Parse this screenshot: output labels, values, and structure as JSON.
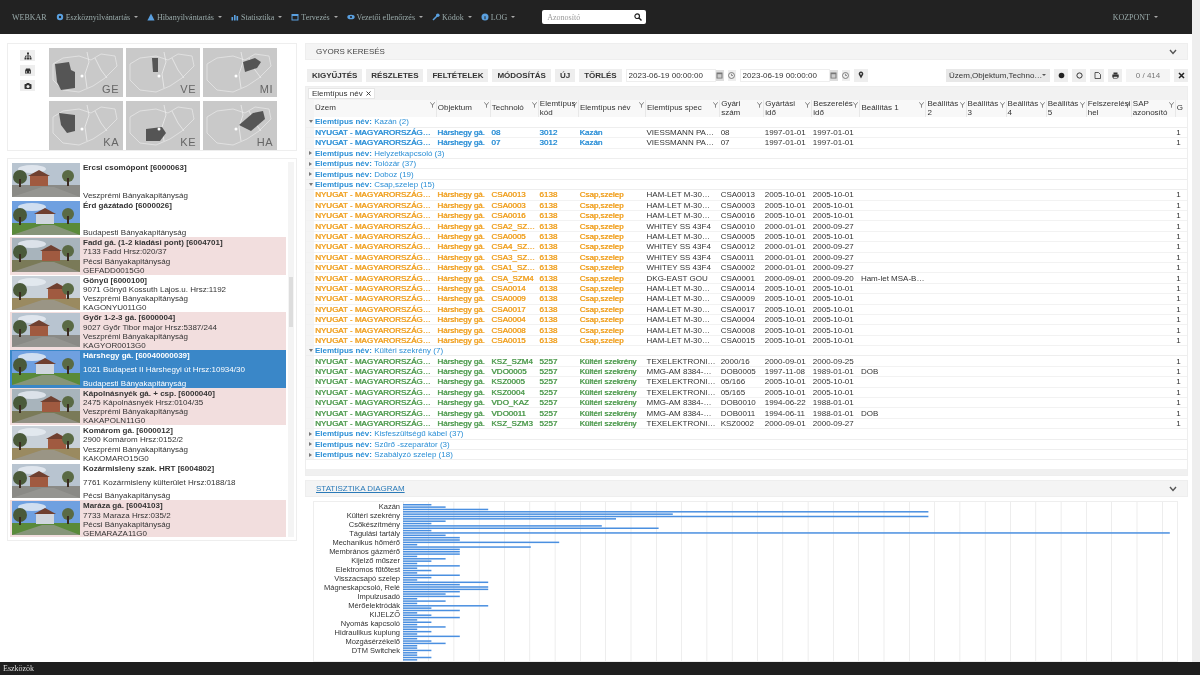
{
  "navbar": {
    "brand": "WEBKAR",
    "menus": [
      {
        "label": "Eszköznyilvántartás"
      },
      {
        "label": "Hibanyilvántartás"
      },
      {
        "label": "Statisztika"
      },
      {
        "label": "Tervezés"
      },
      {
        "label": "Vezetői ellenőrzés"
      },
      {
        "label": "Kódok"
      },
      {
        "label": "LOG"
      }
    ],
    "search": {
      "placeholder": "Azonosító"
    },
    "user_menu": "KOZPONT"
  },
  "region_maps": [
    {
      "code": "GE"
    },
    {
      "code": "VE"
    },
    {
      "code": "MI"
    },
    {
      "code": "KA"
    },
    {
      "code": "KE"
    },
    {
      "code": "HA"
    }
  ],
  "stations": [
    {
      "name": "Ercsi csomópont [6000063]",
      "authority": "Veszprémi Bányakapitányság",
      "flagged": false,
      "selected": false
    },
    {
      "name": "Érd gázátadó [6000026]",
      "authority": "Budapesti Bányakapitányság",
      "flagged": false,
      "selected": false
    },
    {
      "name": "Fadd gá. (1-2 kiadási pont) [6004701]",
      "address": "7133 Fadd Hrsz:020/37",
      "authority": "Pécsi Bányakapitányság",
      "code": "GEFADD0015G0",
      "flagged": true,
      "selected": false
    },
    {
      "name": "Gönyű [6000100]",
      "address": "9071 Gönyű Kossuth Lajos.u. Hrsz:1192",
      "authority": "Veszprémi Bányakapitányság",
      "code": "KAGONYU011G0",
      "flagged": false,
      "selected": false
    },
    {
      "name": "Győr 1-2-3 gá. [6000004]",
      "address": "9027 Győr Tibor major Hrsz:5387/244",
      "authority": "Veszprémi Bányakapitányság",
      "code": "KAGYOR0013G0",
      "flagged": true,
      "selected": false
    },
    {
      "name": "Hárshegy gá. [60040000039]",
      "address": "1021 Budapest II Hárshegyi út Hrsz:10934/30",
      "authority": "Budapesti Bányakapitányság",
      "flagged": false,
      "selected": true
    },
    {
      "name": "Kápolnásnyék gá. + csp. [6000040]",
      "address": "2475 Kápolnásnyék Hrsz:0104/35",
      "authority": "Veszprémi Bányakapitányság",
      "code": "KAKAPOLN11G0",
      "flagged": true,
      "selected": false
    },
    {
      "name": "Komárom gá. [6000012]",
      "address": "2900 Komárom Hrsz:0152/2",
      "authority": "Veszprémi Bányakapitányság",
      "code": "KAKOMARO15G0",
      "flagged": false,
      "selected": false
    },
    {
      "name": "Kozármisleny szak. HRT [6004802]",
      "address": "7761 Kozármisleny külterület Hrsz:0188/18",
      "authority": "Pécsi Bányakapitányság",
      "flagged": false,
      "selected": false
    },
    {
      "name": "Maráza gá. [6004103]",
      "address": "7733 Maraza Hrsz:035/2",
      "authority": "Pécsi Bányakapitányság",
      "code": "GEMARAZA11G0",
      "flagged": true,
      "selected": false
    }
  ],
  "quick_search": {
    "title": "GYORS KERESÉS",
    "buttons": [
      "KIGYŰJTÉS",
      "RÉSZLETES",
      "FELTÉTELEK",
      "MÓDOSÍTÁS",
      "ÚJ",
      "TÖRLÉS"
    ],
    "date_from": "2023-06-19 00:00:00",
    "date_to": "2023-06-19 00:00:00",
    "columns_select": "Üzem,Objektum,Techno…",
    "counter": "0 / 414"
  },
  "table": {
    "group_chip": "Elemtípus név",
    "columns": [
      {
        "label": "Üzem",
        "filter": true
      },
      {
        "label": "Objektum",
        "filter": true
      },
      {
        "label": "Technoló",
        "filter": true
      },
      {
        "label": "Elemtípus kód",
        "filter": true
      },
      {
        "label": "Elemtípus név",
        "filter": true
      },
      {
        "label": "Elemtípus spec",
        "filter": true
      },
      {
        "label": "Gyári szám",
        "filter": true
      },
      {
        "label": "Gyártási idő",
        "filter": true
      },
      {
        "label": "Beszerelés idő",
        "filter": true
      },
      {
        "label": "Beállítás 1",
        "filter": true
      },
      {
        "label": "Beállítás 2",
        "filter": true
      },
      {
        "label": "Beállítás 3",
        "filter": true
      },
      {
        "label": "Beállítás 4",
        "filter": true
      },
      {
        "label": "Beállítás 5",
        "filter": true
      },
      {
        "label": "Felszerelési hel",
        "filter": true
      },
      {
        "label": "SAP azonosító",
        "filter": true
      },
      {
        "label": "G",
        "filter": false
      }
    ],
    "groups": [
      {
        "title": "**Elemtípus név:** Kazán (2)",
        "expanded": true,
        "color": "#2b8fd6",
        "rows": [
          {
            "plant": "NYUGAT - MAGYARORSZÁG…",
            "object": "Hárshegy gá.",
            "technology": "08",
            "type_code": "3012",
            "type_name": "Kazán",
            "type_spec": "VIESSMANN PA…",
            "serial": "08",
            "manufactured": "1997-01-01",
            "installed": "1997-01-01",
            "column_17": "1"
          },
          {
            "plant": "NYUGAT - MAGYARORSZÁG…",
            "object": "Hárshegy gá.",
            "technology": "07",
            "type_code": "3012",
            "type_name": "Kazán",
            "type_spec": "VIESSMANN PA…",
            "serial": "07",
            "manufactured": "1997-01-01",
            "installed": "1997-01-01",
            "column_17": "1"
          }
        ]
      },
      {
        "title": "**Elemtípus név:** Helyzetkapcsoló (3)",
        "expanded": false
      },
      {
        "title": "**Elemtípus név:** Tolózár (37)",
        "expanded": false
      },
      {
        "title": "**Elemtípus név:** Doboz (19)",
        "expanded": false
      },
      {
        "title": "**Elemtípus név:** Csap,szelep (15)",
        "expanded": true,
        "color": "#f0a020",
        "rows": [
          {
            "plant": "NYUGAT - MAGYARORSZÁG…",
            "object": "Hárshegy gá.",
            "technology": "CSA0013",
            "type_code": "6138",
            "type_name": "Csap,szelep",
            "type_spec": "HAM-LET M-30…",
            "serial": "CSA0013",
            "manufactured": "2005-10-01",
            "installed": "2005-10-01",
            "column_17": "1"
          },
          {
            "plant": "NYUGAT - MAGYARORSZÁG…",
            "object": "Hárshegy gá.",
            "technology": "CSA0003",
            "type_code": "6138",
            "type_name": "Csap,szelep",
            "type_spec": "HAM-LET M-30…",
            "serial": "CSA0003",
            "manufactured": "2005-10-01",
            "installed": "2005-10-01",
            "column_17": "1"
          },
          {
            "plant": "NYUGAT - MAGYARORSZÁG…",
            "object": "Hárshegy gá.",
            "technology": "CSA0016",
            "type_code": "6138",
            "type_name": "Csap,szelep",
            "type_spec": "HAM-LET M-30…",
            "serial": "CSA0016",
            "manufactured": "2005-10-01",
            "installed": "2005-10-01",
            "column_17": "1"
          },
          {
            "plant": "NYUGAT - MAGYARORSZÁG…",
            "object": "Hárshegy gá.",
            "technology": "CSA2_SZ…",
            "type_code": "6138",
            "type_name": "Csap,szelep",
            "type_spec": "WHITEY SS 43F4",
            "serial": "CSA0010",
            "manufactured": "2000-01-01",
            "installed": "2000-09-27",
            "column_17": "1"
          },
          {
            "plant": "NYUGAT - MAGYARORSZÁG…",
            "object": "Hárshegy gá.",
            "technology": "CSA0005",
            "type_code": "6138",
            "type_name": "Csap,szelep",
            "type_spec": "HAM-LET M-30…",
            "serial": "CSA0005",
            "manufactured": "2005-10-01",
            "installed": "2005-10-01",
            "column_17": "1"
          },
          {
            "plant": "NYUGAT - MAGYARORSZÁG…",
            "object": "Hárshegy gá.",
            "technology": "CSA4_SZ…",
            "type_code": "6138",
            "type_name": "Csap,szelep",
            "type_spec": "WHITEY SS 43F4",
            "serial": "CSA0012",
            "manufactured": "2000-01-01",
            "installed": "2000-09-27",
            "column_17": "1"
          },
          {
            "plant": "NYUGAT - MAGYARORSZÁG…",
            "object": "Hárshegy gá.",
            "technology": "CSA3_SZ…",
            "type_code": "6138",
            "type_name": "Csap,szelep",
            "type_spec": "WHITEY SS 43F4",
            "serial": "CSA0011",
            "manufactured": "2000-01-01",
            "installed": "2000-09-27",
            "column_17": "1"
          },
          {
            "plant": "NYUGAT - MAGYARORSZÁG…",
            "object": "Hárshegy gá.",
            "technology": "CSA1_SZ…",
            "type_code": "6138",
            "type_name": "Csap,szelep",
            "type_spec": "WHITEY SS 43F4",
            "serial": "CSA0002",
            "manufactured": "2000-01-01",
            "installed": "2000-09-27",
            "column_17": "1"
          },
          {
            "plant": "NYUGAT - MAGYARORSZÁG…",
            "object": "Hárshegy gá.",
            "technology": "CSA_SZM4",
            "type_code": "6138",
            "type_name": "Csap,szelep",
            "type_spec": "DKG-EAST GOU",
            "serial": "CSA0001",
            "manufactured": "2000-09-01",
            "installed": "2000-09-20",
            "setting_1": "Ham-let MSA-B…",
            "column_17": "1"
          },
          {
            "plant": "NYUGAT - MAGYARORSZÁG…",
            "object": "Hárshegy gá.",
            "technology": "CSA0014",
            "type_code": "6138",
            "type_name": "Csap,szelep",
            "type_spec": "HAM-LET M-30…",
            "serial": "CSA0014",
            "manufactured": "2005-10-01",
            "installed": "2005-10-01",
            "column_17": "1"
          },
          {
            "plant": "NYUGAT - MAGYARORSZÁG…",
            "object": "Hárshegy gá.",
            "technology": "CSA0009",
            "type_code": "6138",
            "type_name": "Csap,szelep",
            "type_spec": "HAM-LET M-30…",
            "serial": "CSA0009",
            "manufactured": "2005-10-01",
            "installed": "2005-10-01",
            "column_17": "1"
          },
          {
            "plant": "NYUGAT - MAGYARORSZÁG…",
            "object": "Hárshegy gá.",
            "technology": "CSA0017",
            "type_code": "6138",
            "type_name": "Csap,szelep",
            "type_spec": "HAM-LET M-30…",
            "serial": "CSA0017",
            "manufactured": "2005-10-01",
            "installed": "2005-10-01",
            "column_17": "1"
          },
          {
            "plant": "NYUGAT - MAGYARORSZÁG…",
            "object": "Hárshegy gá.",
            "technology": "CSA0004",
            "type_code": "6138",
            "type_name": "Csap,szelep",
            "type_spec": "HAM-LET M-30…",
            "serial": "CSA0004",
            "manufactured": "2005-10-01",
            "installed": "2005-10-01",
            "column_17": "1"
          },
          {
            "plant": "NYUGAT - MAGYARORSZÁG…",
            "object": "Hárshegy gá.",
            "technology": "CSA0008",
            "type_code": "6138",
            "type_name": "Csap,szelep",
            "type_spec": "HAM-LET M-30…",
            "serial": "CSA0008",
            "manufactured": "2005-10-01",
            "installed": "2005-10-01",
            "column_17": "1"
          },
          {
            "plant": "NYUGAT - MAGYARORSZÁG…",
            "object": "Hárshegy gá.",
            "technology": "CSA0015",
            "type_code": "6138",
            "type_name": "Csap,szelep",
            "type_spec": "HAM-LET M-30…",
            "serial": "CSA0015",
            "manufactured": "2005-10-01",
            "installed": "2005-10-01",
            "column_17": "1"
          }
        ]
      },
      {
        "title": "**Elemtípus név:** Kültéri szekrény (7)",
        "expanded": true,
        "color": "#4e9a4e",
        "rows": [
          {
            "plant": "NYUGAT - MAGYARORSZÁG…",
            "object": "Hárshegy gá.",
            "technology": "KSZ_SZM4",
            "type_code": "5257",
            "type_name": "Kültéri szekrény",
            "type_spec": "TEXELEKTRONI…",
            "serial": "2000/16",
            "manufactured": "2000-09-01",
            "installed": "2000-09-25",
            "column_17": "1"
          },
          {
            "plant": "NYUGAT - MAGYARORSZÁG…",
            "object": "Hárshegy gá.",
            "technology": "VDO0005",
            "type_code": "5257",
            "type_name": "Kültéri szekrény",
            "type_spec": "MMG-AM 8384-…",
            "serial": "DOB0005",
            "manufactured": "1997-11-08",
            "installed": "1989-01-01",
            "setting_1": "DOB",
            "column_17": "1"
          },
          {
            "plant": "NYUGAT - MAGYARORSZÁG…",
            "object": "Hárshegy gá.",
            "technology": "KSZ0005",
            "type_code": "5257",
            "type_name": "Kültéri szekrény",
            "type_spec": "TEXELEKTRONI…",
            "serial": "05/166",
            "manufactured": "2005-10-01",
            "installed": "2005-10-01",
            "column_17": "1"
          },
          {
            "plant": "NYUGAT - MAGYARORSZÁG…",
            "object": "Hárshegy gá.",
            "technology": "KSZ0004",
            "type_code": "5257",
            "type_name": "Kültéri szekrény",
            "type_spec": "TEXELEKTRONI…",
            "serial": "05/165",
            "manufactured": "2005-10-01",
            "installed": "2005-10-01",
            "column_17": "1"
          },
          {
            "plant": "NYUGAT - MAGYARORSZÁG…",
            "object": "Hárshegy gá.",
            "technology": "VDO_KAZ",
            "type_code": "5257",
            "type_name": "Kültéri szekrény",
            "type_spec": "MMG-AM 8384-…",
            "serial": "DOB0010",
            "manufactured": "1994-06-22",
            "installed": "1988-01-01",
            "column_17": "1"
          },
          {
            "plant": "NYUGAT - MAGYARORSZÁG…",
            "object": "Hárshegy gá.",
            "technology": "VDO0011",
            "type_code": "5257",
            "type_name": "Kültéri szekrény",
            "type_spec": "MMG-AM 8384-…",
            "serial": "DOB0011",
            "manufactured": "1994-06-11",
            "installed": "1988-01-01",
            "setting_1": "DOB",
            "column_17": "1"
          },
          {
            "plant": "NYUGAT - MAGYARORSZÁG…",
            "object": "Hárshegy gá.",
            "technology": "KSZ_SZM3",
            "type_code": "5257",
            "type_name": "Kültéri szekrény",
            "type_spec": "TEXELEKTRONI…",
            "serial": "KSZ0002",
            "manufactured": "2000-09-01",
            "installed": "2000-09-27",
            "column_17": "1"
          }
        ]
      },
      {
        "title": "**Elemtípus név:** Kisfeszültségű kábel (37)",
        "expanded": false
      },
      {
        "title": "**Elemtípus név:** Szűrő -szeparátor (3)",
        "expanded": false
      },
      {
        "title": "**Elemtípus név:** Szabályzó szelep (18)",
        "expanded": false
      }
    ]
  },
  "statistics": {
    "title": "STATISZTIKA DIAGRAM",
    "categories": [
      "Kazán",
      "Kültéri szekrény",
      "Csőkészítmény",
      "Tágulási tartály",
      "Mechanikus hőmérő",
      "Membrános gázmérő",
      "Kijelző műszer",
      "Elektromos fűtőtest",
      "Visszacsapó szelep",
      "Mágneskapcsoló, Relé",
      "Impulzusadó",
      "Mérőelektródák",
      "KIJELZŐ",
      "Nyomás kapcsoló",
      "Hidraulikus kuplung",
      "Mozgásérzékelő",
      "DTM Switchek"
    ]
  },
  "footer": {
    "label": "Eszközök"
  }
}
